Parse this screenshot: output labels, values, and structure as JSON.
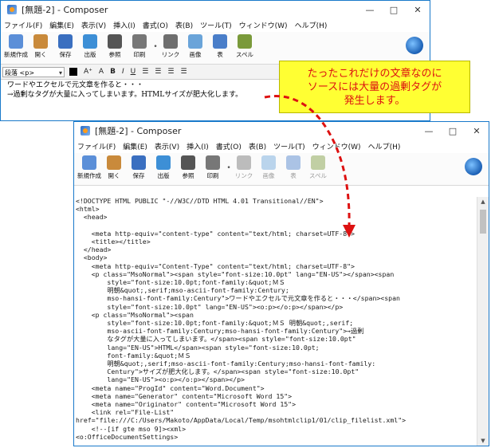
{
  "win1": {
    "title": "[無題-2] - Composer",
    "winbtns": [
      "—",
      "□",
      "✕"
    ],
    "menu": [
      "ファイル(F)",
      "編集(E)",
      "表示(V)",
      "挿入(I)",
      "書式(O)",
      "表(B)",
      "ツール(T)",
      "ウィンドウ(W)",
      "ヘルプ(H)"
    ],
    "toolbar": [
      {
        "label": "新規作成",
        "icon": "new-file-icon",
        "color": "#5b8fd8"
      },
      {
        "label": "開く",
        "icon": "open-folder-icon",
        "color": "#c98a3b"
      },
      {
        "label": "保存",
        "icon": "save-disk-icon",
        "color": "#3a6fc0"
      },
      {
        "label": "出版",
        "icon": "publish-icon",
        "color": "#3d8fd6"
      },
      {
        "label": "参照",
        "icon": "browse-eye-icon",
        "color": "#555555"
      },
      {
        "label": "印刷",
        "icon": "printer-icon",
        "color": "#777777"
      },
      {
        "label": "リンク",
        "icon": "link-icon",
        "color": "#6e6e6e"
      },
      {
        "label": "画像",
        "icon": "image-icon",
        "color": "#6aa4d9"
      },
      {
        "label": "表",
        "icon": "table-icon",
        "color": "#4a7ec9"
      },
      {
        "label": "スペル",
        "icon": "spell-check-icon",
        "color": "#7a9a3a"
      }
    ],
    "format": {
      "paragraph": "段落 <p>",
      "buttons": [
        "A⁺",
        "A",
        "B",
        "I",
        "U",
        "☰",
        "☰",
        "☰",
        "☰"
      ]
    },
    "content": [
      "ワードやエクセルで元文章を作ると・・・",
      "→過剰なタグが大量に入ってしまいます。HTMLサイズが肥大化します。"
    ]
  },
  "win2": {
    "title": "[無題-2] - Composer",
    "winbtns": [
      "—",
      "□",
      "✕"
    ],
    "menu": [
      "ファイル(F)",
      "編集(E)",
      "表示(V)",
      "挿入(I)",
      "書式(O)",
      "表(B)",
      "ツール(T)",
      "ウィンドウ(W)",
      "ヘルプ(H)"
    ],
    "toolbar": [
      {
        "label": "新規作成",
        "icon": "new-file-icon",
        "color": "#5b8fd8",
        "disabled": false
      },
      {
        "label": "開く",
        "icon": "open-folder-icon",
        "color": "#c98a3b",
        "disabled": false
      },
      {
        "label": "保存",
        "icon": "save-disk-icon",
        "color": "#3a6fc0",
        "disabled": false
      },
      {
        "label": "出版",
        "icon": "publish-icon",
        "color": "#3d8fd6",
        "disabled": false
      },
      {
        "label": "参照",
        "icon": "browse-eye-icon",
        "color": "#555555",
        "disabled": false
      },
      {
        "label": "印刷",
        "icon": "printer-icon",
        "color": "#777777",
        "disabled": false
      },
      {
        "label": "リンク",
        "icon": "link-icon",
        "color": "#6e6e6e",
        "disabled": true
      },
      {
        "label": "画像",
        "icon": "image-icon",
        "color": "#6aa4d9",
        "disabled": true
      },
      {
        "label": "表",
        "icon": "table-icon",
        "color": "#4a7ec9",
        "disabled": true
      },
      {
        "label": "スペル",
        "icon": "spell-check-icon",
        "color": "#7a9a3a",
        "disabled": true
      }
    ],
    "source_lines": [
      "<!DOCTYPE HTML PUBLIC \"-//W3C//DTD HTML 4.01 Transitional//EN\">",
      "<html>",
      "  <head>",
      "",
      "    <meta http-equiv=\"content-type\" content=\"text/html; charset=UTF-8\">",
      "    <title></title>",
      "  </head>",
      "  <body>",
      "    <meta http-equiv=\"Content-Type\" content=\"text/html; charset=UTF-8\">",
      "    <p class=\"MsoNormal\"><span style=\"font-size:10.0pt\" lang=\"EN-US\"></span><span",
      "        style=\"font-size:10.0pt;font-family:&quot;ＭＳ",
      "        明朝&quot;,serif;mso-ascii-font-family:Century;",
      "        mso-hansi-font-family:Century\">ワードやエクセルで元文章を作ると・・・</span><span",
      "        style=\"font-size:10.0pt\" lang=\"EN-US\"><o:p></o:p></span></p>",
      "    <p class=\"MsoNormal\"><span",
      "        style=\"font-size:10.0pt;font-family:&quot;ＭＳ 明朝&quot;,serif;",
      "        mso-ascii-font-family:Century;mso-hansi-font-family:Century\">→過剰",
      "        なタグが大量に入ってしまいます。</span><span style=\"font-size:10.0pt\"",
      "        lang=\"EN-US\">HTML</span><span style=\"font-size:10.0pt;",
      "        font-family:&quot;ＭＳ",
      "        明朝&quot;,serif;mso-ascii-font-family:Century;mso-hansi-font-family:",
      "        Century\">サイズが肥大化します。</span><span style=\"font-size:10.0pt\"",
      "        lang=\"EN-US\"><o:p></o:p></span></p>",
      "    <meta name=\"ProgId\" content=\"Word.Document\">",
      "    <meta name=\"Generator\" content=\"Microsoft Word 15\">",
      "    <meta name=\"Originator\" content=\"Microsoft Word 15\">",
      "    <link rel=\"File-List\"",
      "href=\"file:///C:/Users/Makoto/AppData/Local/Temp/msohtmlclip1/01/clip_filelist.xml\">",
      "    <!--[if gte mso 9]><xml>",
      "<o:OfficeDocumentSettings>"
    ]
  },
  "callout": {
    "lines": [
      "たったこれだけの文章なのに",
      "ソースには大量の過剰タグが",
      "発生します。"
    ],
    "text_color": "#dd1111",
    "bg_color": "#ffff33"
  },
  "arrow_color": "#dd1111"
}
